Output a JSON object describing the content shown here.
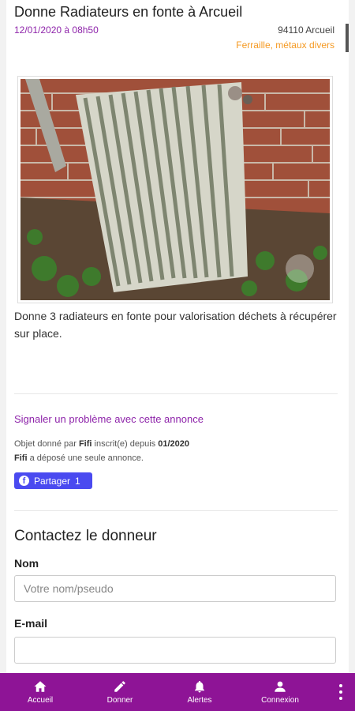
{
  "listing": {
    "title": "Donne Radiateurs en fonte à Arcueil",
    "date": "12/01/2020 à 08h50",
    "location": "94110 Arcueil",
    "category": "Ferraille, métaux divers",
    "description": "Donne 3 radiateurs en fonte pour valorisation déchets à récupérer sur place."
  },
  "report_link": "Signaler un problème avec cette annonce",
  "donor": {
    "prefix": "Objet donné par",
    "name": "Fifi",
    "registered": "inscrit(e) depuis",
    "since": "01/2020",
    "name2": "Fifi",
    "ads_text": "a déposé une seule annonce."
  },
  "share": {
    "label": "Partager",
    "count": "1"
  },
  "contact": {
    "title": "Contactez le donneur",
    "name_label": "Nom",
    "name_placeholder": "Votre nom/pseudo",
    "email_label": "E-mail",
    "email_placeholder": ""
  },
  "nav": {
    "items": [
      {
        "label": "Accueil",
        "icon": "home-icon"
      },
      {
        "label": "Donner",
        "icon": "pencil-icon"
      },
      {
        "label": "Alertes",
        "icon": "bell-icon"
      },
      {
        "label": "Connexion",
        "icon": "user-icon"
      }
    ],
    "more_icon": "more-vertical-icon"
  },
  "colors": {
    "accent": "#8e24aa",
    "nav_bg": "#8e1496",
    "category": "#f59a23",
    "share_bg": "#4a4af0"
  }
}
